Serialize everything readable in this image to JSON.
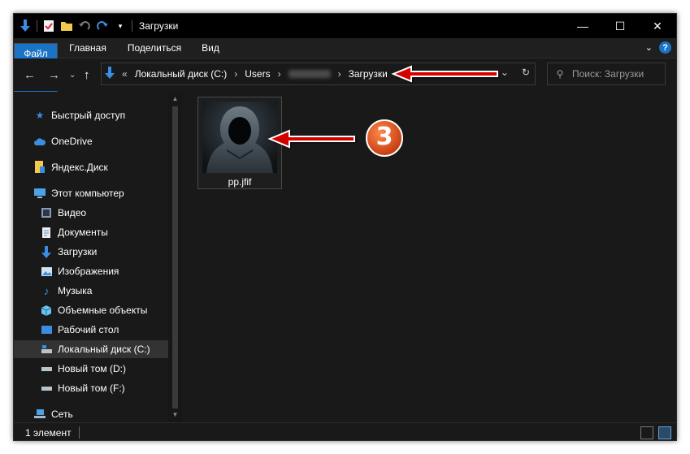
{
  "window": {
    "title": "Загрузки"
  },
  "qat": {
    "download_icon": "download-arrow-icon",
    "properties_icon": "properties-check-icon",
    "new_folder_icon": "folder-icon",
    "undo_icon": "undo-icon",
    "redo_icon": "redo-icon",
    "customize_icon": "qat-dropdown-icon"
  },
  "ribbon": {
    "tabs": [
      {
        "label": "Файл"
      },
      {
        "label": "Главная"
      },
      {
        "label": "Поделиться"
      },
      {
        "label": "Вид"
      }
    ],
    "help_label": "?"
  },
  "address": {
    "prefix": "«",
    "crumbs": [
      "Локальный диск (C:)",
      "Users",
      "Загрузки"
    ]
  },
  "search": {
    "placeholder": "Поиск: Загрузки"
  },
  "sidebar": {
    "items": [
      {
        "label": "Быстрый доступ",
        "icon": "star-icon"
      },
      {
        "label": "OneDrive",
        "icon": "cloud-icon"
      },
      {
        "label": "Яндекс.Диск",
        "icon": "yandex-disk-icon"
      },
      {
        "label": "Этот компьютер",
        "icon": "computer-icon"
      },
      {
        "label": "Видео",
        "icon": "video-icon"
      },
      {
        "label": "Документы",
        "icon": "documents-icon"
      },
      {
        "label": "Загрузки",
        "icon": "download-icon"
      },
      {
        "label": "Изображения",
        "icon": "pictures-icon"
      },
      {
        "label": "Музыка",
        "icon": "music-icon"
      },
      {
        "label": "Объемные объекты",
        "icon": "3d-objects-icon"
      },
      {
        "label": "Рабочий стол",
        "icon": "desktop-icon"
      },
      {
        "label": "Локальный диск (C:)",
        "icon": "drive-c-icon"
      },
      {
        "label": "Новый том (D:)",
        "icon": "drive-icon"
      },
      {
        "label": "Новый том (F:)",
        "icon": "drive-icon"
      },
      {
        "label": "Сеть",
        "icon": "network-icon"
      }
    ],
    "selected": "Локальный диск (C:)"
  },
  "files": [
    {
      "name": "pp.jfif"
    }
  ],
  "annotation": {
    "number": "3"
  },
  "status": {
    "text": "1 элемент"
  },
  "colors": {
    "accent": "#1a73c5",
    "annotation_red": "#d40000",
    "badge_orange": "#e8561c"
  }
}
